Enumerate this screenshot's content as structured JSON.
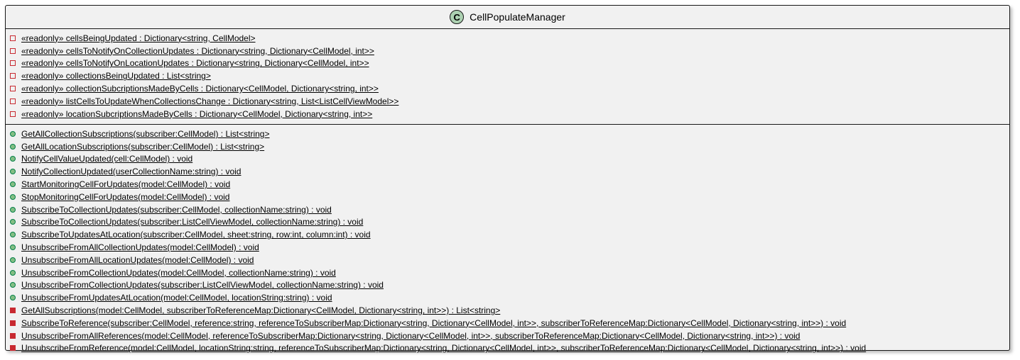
{
  "class": {
    "name": "CellPopulateManager",
    "stereotype_letter": "C",
    "stereotype_color": "#add1b2",
    "fields": [
      {
        "visibility": "private",
        "text": "«readonly»   cellsBeingUpdated : Dictionary<string, CellModel>"
      },
      {
        "visibility": "private",
        "text": "«readonly»   cellsToNotifyOnCollectionUpdates : Dictionary<string, Dictionary<CellModel, int>>"
      },
      {
        "visibility": "private",
        "text": "«readonly»   cellsToNotifyOnLocationUpdates : Dictionary<string, Dictionary<CellModel, int>>"
      },
      {
        "visibility": "private",
        "text": "«readonly»   collectionsBeingUpdated : List<string>"
      },
      {
        "visibility": "private",
        "text": "«readonly»   collectionSubcriptionsMadeByCells : Dictionary<CellModel, Dictionary<string, int>>"
      },
      {
        "visibility": "private",
        "text": "«readonly»   listCellsToUpdateWhenCollectionsChange : Dictionary<string, List<ListCellViewModel>>"
      },
      {
        "visibility": "private",
        "text": "«readonly»   locationSubcriptionsMadeByCells : Dictionary<CellModel, Dictionary<string, int>>"
      }
    ],
    "methods": [
      {
        "visibility": "public",
        "text": "GetAllCollectionSubscriptions(subscriber:CellModel) : List<string>"
      },
      {
        "visibility": "public",
        "text": "GetAllLocationSubscriptions(subscriber:CellModel) : List<string>"
      },
      {
        "visibility": "public",
        "text": "NotifyCellValueUpdated(cell:CellModel) : void"
      },
      {
        "visibility": "public",
        "text": "NotifyCollectionUpdated(userCollectionName:string) : void"
      },
      {
        "visibility": "public",
        "text": "StartMonitoringCellForUpdates(model:CellModel) : void"
      },
      {
        "visibility": "public",
        "text": "StopMonitoringCellForUpdates(model:CellModel) : void"
      },
      {
        "visibility": "public",
        "text": "SubscribeToCollectionUpdates(subscriber:CellModel, collectionName:string) : void"
      },
      {
        "visibility": "public",
        "text": "SubscribeToCollectionUpdates(subscriber:ListCellViewModel, collectionName:string) : void"
      },
      {
        "visibility": "public",
        "text": "SubscribeToUpdatesAtLocation(subscriber:CellModel, sheet:string, row:int, column:int) : void"
      },
      {
        "visibility": "public",
        "text": "UnsubscribeFromAllCollectionUpdates(model:CellModel) : void"
      },
      {
        "visibility": "public",
        "text": "UnsubscribeFromAllLocationUpdates(model:CellModel) : void"
      },
      {
        "visibility": "public",
        "text": "UnsubscribeFromCollectionUpdates(model:CellModel, collectionName:string) : void"
      },
      {
        "visibility": "public",
        "text": "UnsubscribeFromCollectionUpdates(subscriber:ListCellViewModel, collectionName:string) : void"
      },
      {
        "visibility": "public",
        "text": "UnsubscribeFromUpdatesAtLocation(model:CellModel, locationString:string) : void"
      },
      {
        "visibility": "private",
        "text": "GetAllSubscriptions(model:CellModel, subscriberToReferenceMap:Dictionary<CellModel, Dictionary<string, int>>) : List<string>"
      },
      {
        "visibility": "private",
        "text": "SubscribeToReference(subscriber:CellModel, reference:string, referenceToSubscriberMap:Dictionary<string, Dictionary<CellModel, int>>, subscriberToReferenceMap:Dictionary<CellModel, Dictionary<string, int>>) : void"
      },
      {
        "visibility": "private",
        "text": "UnsubscribeFromAllReferences(model:CellModel, referenceToSubscriberMap:Dictionary<string, Dictionary<CellModel, int>>, subscriberToReferenceMap:Dictionary<CellModel, Dictionary<string, int>>) : void"
      },
      {
        "visibility": "private",
        "text": "UnsubscribeFromReference(model:CellModel, locationString:string, referenceToSubscriberMap:Dictionary<string, Dictionary<CellModel, int>>, subscriberToReferenceMap:Dictionary<CellModel, Dictionary<string, int>>) : void"
      }
    ]
  }
}
